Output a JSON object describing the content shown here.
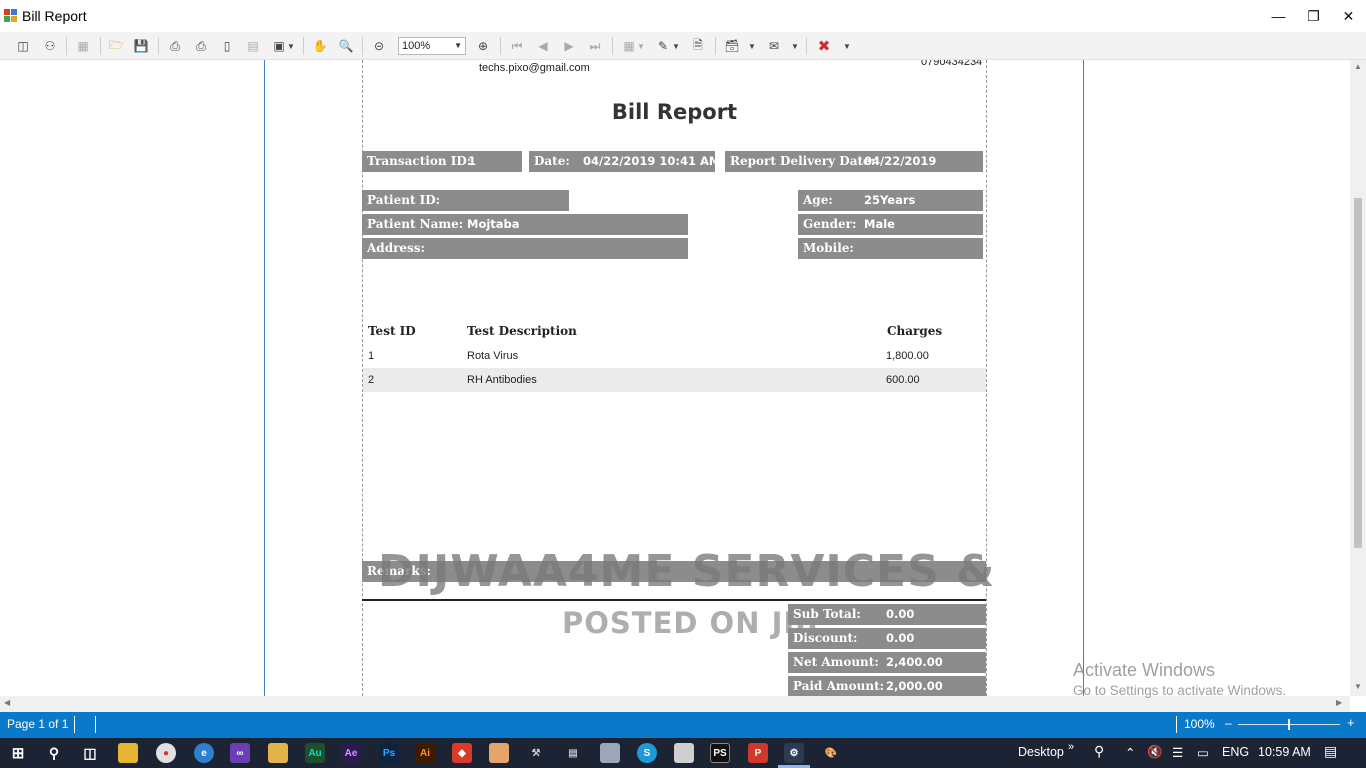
{
  "window": {
    "title": "Bill Report",
    "minimize_icon": "minimize-icon",
    "restore_icon": "restore-icon",
    "close_icon": "close-icon"
  },
  "toolbar": {
    "zoom_value": "100%"
  },
  "report": {
    "email": "techs.pixo@gmail.com",
    "phone": "0790434234",
    "title": "Bill Report",
    "transaction_label": "Transaction ID:",
    "transaction_value": "1",
    "date_label": "Date:",
    "date_value": "04/22/2019 10:41 AM",
    "delivery_label": "Report Delivery Date:",
    "delivery_value": "04/22/2019",
    "patient_id_label": "Patient ID:",
    "patient_id_value": "",
    "patient_name_label": "Patient Name:",
    "patient_name_value": "Mojtaba",
    "address_label": "Address:",
    "address_value": "",
    "age_label": "Age:",
    "age_value": "25Years",
    "gender_label": "Gender:",
    "gender_value": "Male",
    "mobile_label": "Mobile:",
    "mobile_value": "",
    "table": {
      "headers": [
        "Test ID",
        "Test Description",
        "Charges"
      ],
      "rows": [
        {
          "id": "1",
          "description": "Rota Virus",
          "charges": "1,800.00"
        },
        {
          "id": "2",
          "description": "RH Antibodies",
          "charges": "600.00"
        }
      ]
    },
    "remarks_label": "Remarks:",
    "subtotal_label": "Sub Total:",
    "subtotal_value": "0.00",
    "discount_label": "Discount:",
    "discount_value": "0.00",
    "net_label": "Net Amount:",
    "net_value": "2,400.00",
    "paid_label": "Paid Amount:",
    "paid_value": "2,000.00"
  },
  "watermark": {
    "line1": "DIJWAA4ME SERVICES &",
    "line2": "POSTED ON JIJI"
  },
  "activation": {
    "title": "Activate Windows",
    "subtitle": "Go to Settings to activate Windows."
  },
  "status": {
    "page": "Page 1 of 1",
    "zoom": "100%"
  },
  "taskbar": {
    "desktop_label": "Desktop",
    "language": "ENG",
    "time": "10:59 AM"
  }
}
